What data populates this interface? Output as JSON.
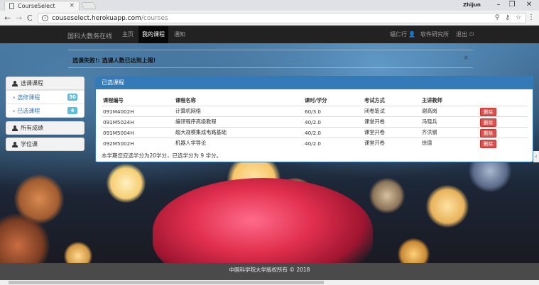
{
  "browser": {
    "tab_title": "CourseSelect",
    "tab_close": "×",
    "user_name": "Zhijun",
    "url_host": "couseselect.herokuapp.com",
    "url_path": "/courses",
    "minimize": "–",
    "maximize": "❐",
    "close": "✕",
    "back": "←",
    "forward": "→",
    "reload": "C"
  },
  "navbar": {
    "brand": "国科大教务在线",
    "items": [
      {
        "label": "主页",
        "active": false
      },
      {
        "label": "我的课程",
        "active": true
      },
      {
        "label": "通知",
        "active": false
      }
    ],
    "right": {
      "user": "辐仁行",
      "institute": "软件研究所",
      "logout": "退出"
    }
  },
  "alert": {
    "text": "选课失败!: 选课人数已达到上限!",
    "close": "×"
  },
  "sidebar": {
    "select": {
      "title": "选课课程",
      "links": [
        {
          "label": "选修课程",
          "count": "30"
        },
        {
          "label": "已选课程",
          "count": "4"
        }
      ]
    },
    "grades": {
      "title": "所有成绩"
    },
    "degree": {
      "title": "学位课"
    }
  },
  "main": {
    "title": "已选课程",
    "headers": [
      "课程编号",
      "课程名称",
      "课时/学分",
      "考试方式",
      "主讲教师",
      ""
    ],
    "rows": [
      {
        "code": "091M4002H",
        "name": "计算机网络",
        "credit": "60/3.0",
        "exam": "闭卷笔试",
        "teacher": "谢高岗",
        "action": "删除"
      },
      {
        "code": "091M5024H",
        "name": "编译程序高级教程",
        "credit": "40/2.0",
        "exam": "课堂开卷",
        "teacher": "冯晓兵",
        "action": "删除"
      },
      {
        "code": "091M5004H",
        "name": "超大规模集成电路基础",
        "credit": "40/2.0",
        "exam": "课堂开卷",
        "teacher": "齐洪钢",
        "action": "删除"
      },
      {
        "code": "092M5002H",
        "name": "机器人学导论",
        "credit": "40/2.0",
        "exam": "课堂开卷",
        "teacher": "徐德",
        "action": "删除"
      }
    ],
    "summary": "本学期您应选学分为20学分，已选学分为 9 学分。"
  },
  "footer": {
    "text": "中国科学院大学版权所有 © 2018"
  },
  "colors": {
    "primary": "#337ab7",
    "danger": "#d9534f",
    "badge": "#5bc0de",
    "navbar": "#222222"
  }
}
